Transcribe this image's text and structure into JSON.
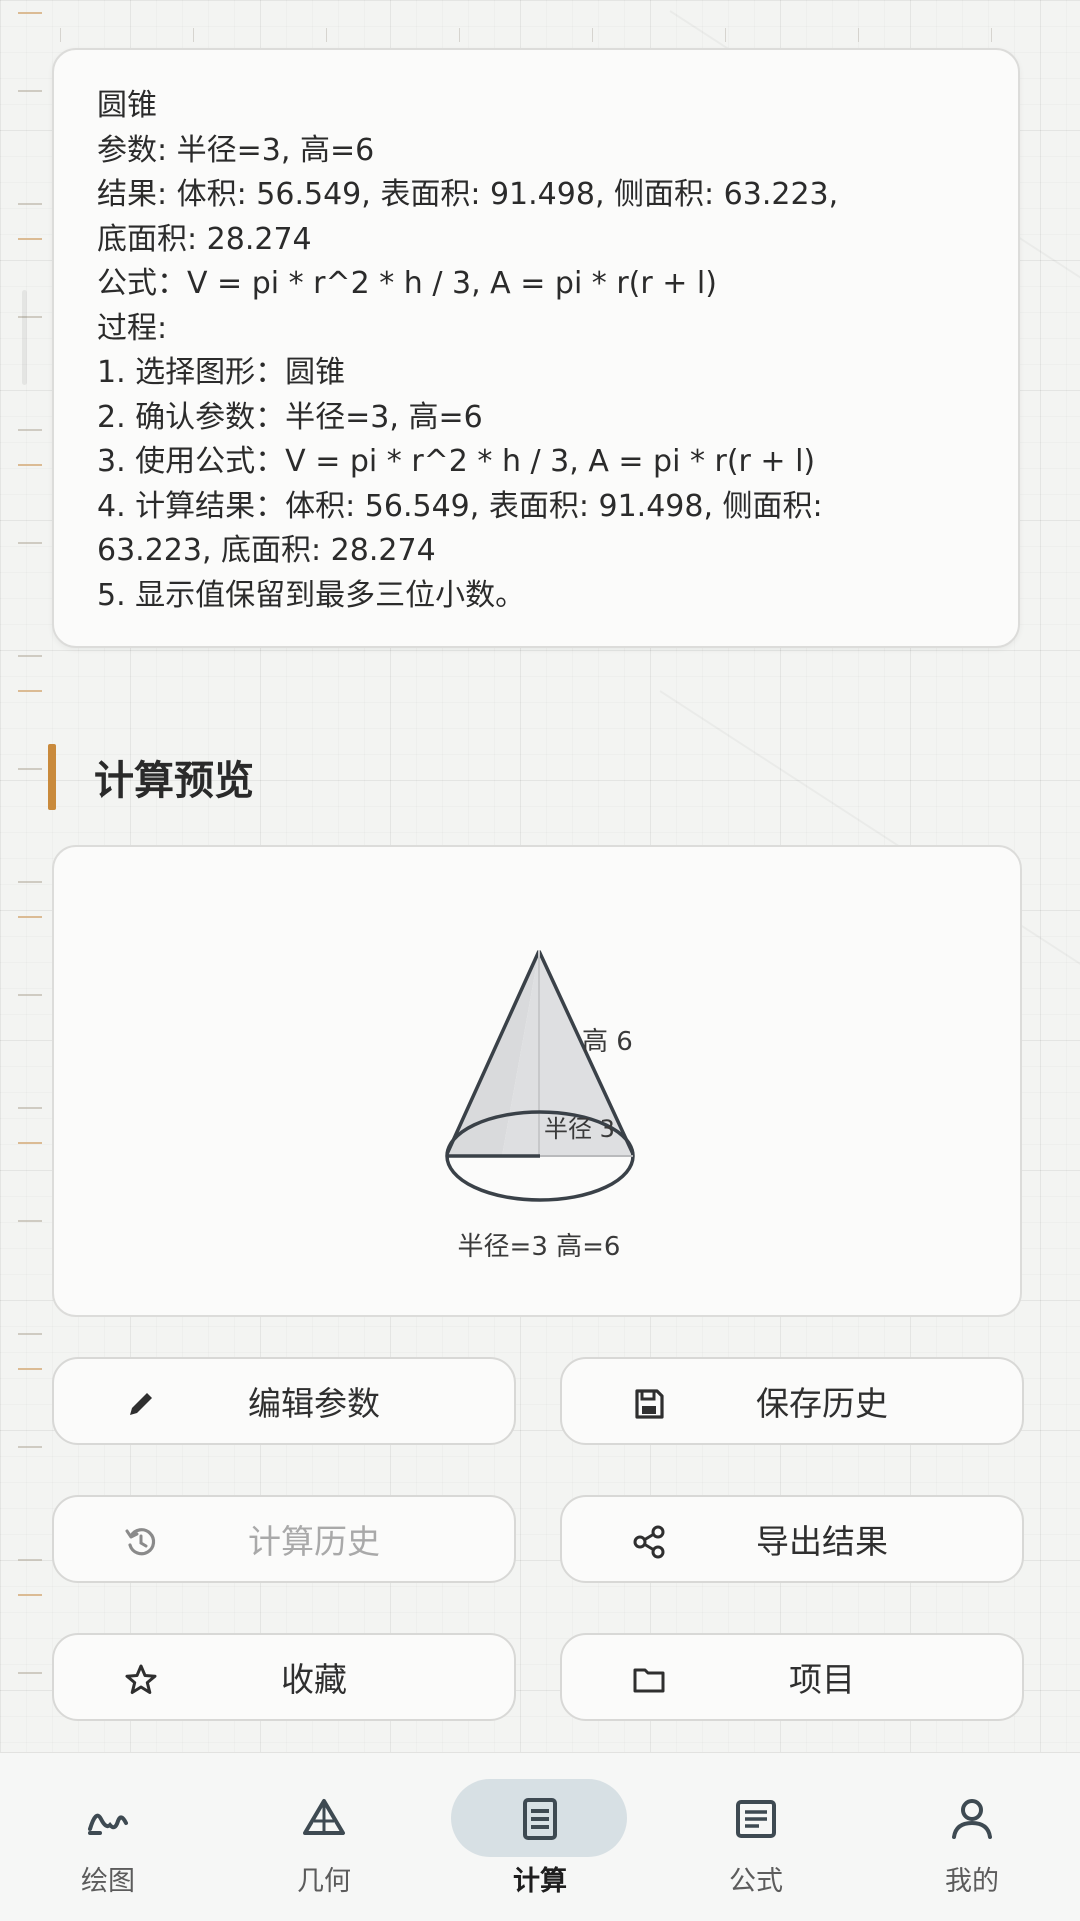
{
  "result_card": {
    "lines": [
      "圆锥",
      "参数: 半径=3, 高=6",
      "结果: 体积: 56.549, 表面积: 91.498, 侧面积: 63.223,",
      "底面积: 28.274",
      "公式：V = pi * r^2 * h / 3, A = pi * r(r + l)",
      "过程:",
      "1. 选择图形：圆锥",
      "2. 确认参数：半径=3, 高=6",
      "3. 使用公式：V = pi * r^2 * h / 3, A = pi * r(r + l)",
      "4. 计算结果：体积: 56.549, 表面积: 91.498, 侧面积:",
      "63.223, 底面积: 28.274",
      "5. 显示值保留到最多三位小数。"
    ]
  },
  "preview": {
    "section_title": "计算预览",
    "height_label": "高 6",
    "radius_label": "半径 3",
    "caption": "半径=3  高=6"
  },
  "actions": {
    "edit_params": "编辑参数",
    "save_history": "保存历史",
    "calc_history": "计算历史",
    "export_result": "导出结果",
    "favorite": "收藏",
    "project": "项目"
  },
  "nav": {
    "items": [
      {
        "label": "绘图",
        "icon": "curve-plot-icon"
      },
      {
        "label": "几何",
        "icon": "geometry-triangle-icon"
      },
      {
        "label": "计算",
        "icon": "calculator-list-icon"
      },
      {
        "label": "公式",
        "icon": "formula-document-icon"
      },
      {
        "label": "我的",
        "icon": "user-profile-icon"
      }
    ],
    "active": "计算"
  },
  "colors": {
    "accent_bar": "#c98a3c",
    "active_pill": "#d7e0e4",
    "cone_fill": "#d9dadc",
    "cone_stroke": "#3a4148"
  }
}
